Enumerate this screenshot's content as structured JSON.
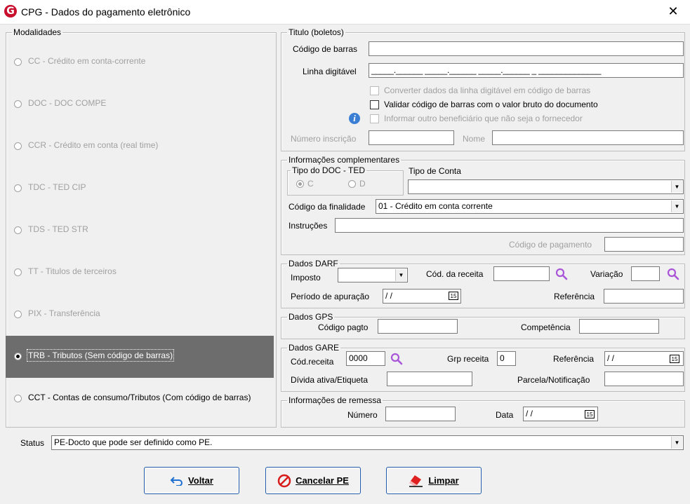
{
  "window": {
    "title": "CPG - Dados do pagamento eletrônico",
    "icon_letter": "G",
    "close_glyph": "✕"
  },
  "modalidades": {
    "legend": "Modalidades",
    "items": [
      {
        "label": "CC  - Crédito em conta-corrente",
        "selected": false,
        "enabled": false
      },
      {
        "label": "DOC - DOC COMPE",
        "selected": false,
        "enabled": false
      },
      {
        "label": "CCR - Crédito em conta (real time)",
        "selected": false,
        "enabled": false
      },
      {
        "label": "TDC - TED CIP",
        "selected": false,
        "enabled": false
      },
      {
        "label": "TDS - TED STR",
        "selected": false,
        "enabled": false
      },
      {
        "label": "TT  - Titulos de terceiros",
        "selected": false,
        "enabled": false
      },
      {
        "label": "PIX - Transferência",
        "selected": false,
        "enabled": false
      },
      {
        "label": "TRB - Tributos (Sem código de barras)",
        "selected": true,
        "enabled": true
      },
      {
        "label": "CCT - Contas de consumo/Tributos (Com código de barras)",
        "selected": false,
        "enabled": true
      }
    ]
  },
  "titulo": {
    "legend": "Titulo (boletos)",
    "codigo_barras_label": "Código de barras",
    "codigo_barras_value": "",
    "linha_digitavel_label": "Linha digitável",
    "linha_digitavel_value": "_____.______ _____.______ _____.______ _ ______________",
    "chk_converter": "Converter dados da linha digitável em código de barras",
    "chk_validar": "Validar código de barras com o valor bruto do documento",
    "chk_informar": "Informar outro beneficiário que não seja o fornecedor",
    "numero_inscricao_label": "Número inscrição",
    "nome_label": "Nome",
    "info_glyph": "i"
  },
  "complementares": {
    "legend": "Informações complementares",
    "tipo_doc_ted_legend": "Tipo do DOC - TED",
    "opt_c": "C",
    "opt_d": "D",
    "tipo_conta_label": "Tipo de Conta",
    "tipo_conta_value": "",
    "finalidade_label": "Código da finalidade",
    "finalidade_value": "01 - Crédito em conta corrente",
    "instrucoes_label": "Instruções",
    "codigo_pagamento_label": "Código de pagamento"
  },
  "darf": {
    "legend": "Dados DARF",
    "imposto_label": "Imposto",
    "cod_receita_label": "Cód. da receita",
    "variacao_label": "Variação",
    "periodo_label": "Período de apuração",
    "periodo_value": " /  /",
    "referencia_label": "Referência"
  },
  "gps": {
    "legend": "Dados GPS",
    "codigo_pagto_label": "Código pagto",
    "competencia_label": "Competência"
  },
  "gare": {
    "legend": "Dados GARE",
    "cod_receita_label": "Cód.receita",
    "cod_receita_value": "0000",
    "grp_receita_label": "Grp receita",
    "grp_receita_value": "0",
    "referencia_label": "Referência",
    "referencia_value": " /  /",
    "divida_label": "Dívida ativa/Etiqueta",
    "parcela_label": "Parcela/Notificação"
  },
  "remessa": {
    "legend": "Informações de remessa",
    "numero_label": "Número",
    "data_label": "Data",
    "data_value": " /  /"
  },
  "status": {
    "label": "Status",
    "value": "PE-Docto  que pode ser definido como PE."
  },
  "buttons": {
    "voltar": "Voltar",
    "cancelar": "Cancelar PE",
    "limpar": "Limpar"
  },
  "colors": {
    "selected_row": "#6d6d6d",
    "button_border": "#1e5aa8",
    "magnifier": "#a855d8",
    "brand": "#c8102e"
  }
}
